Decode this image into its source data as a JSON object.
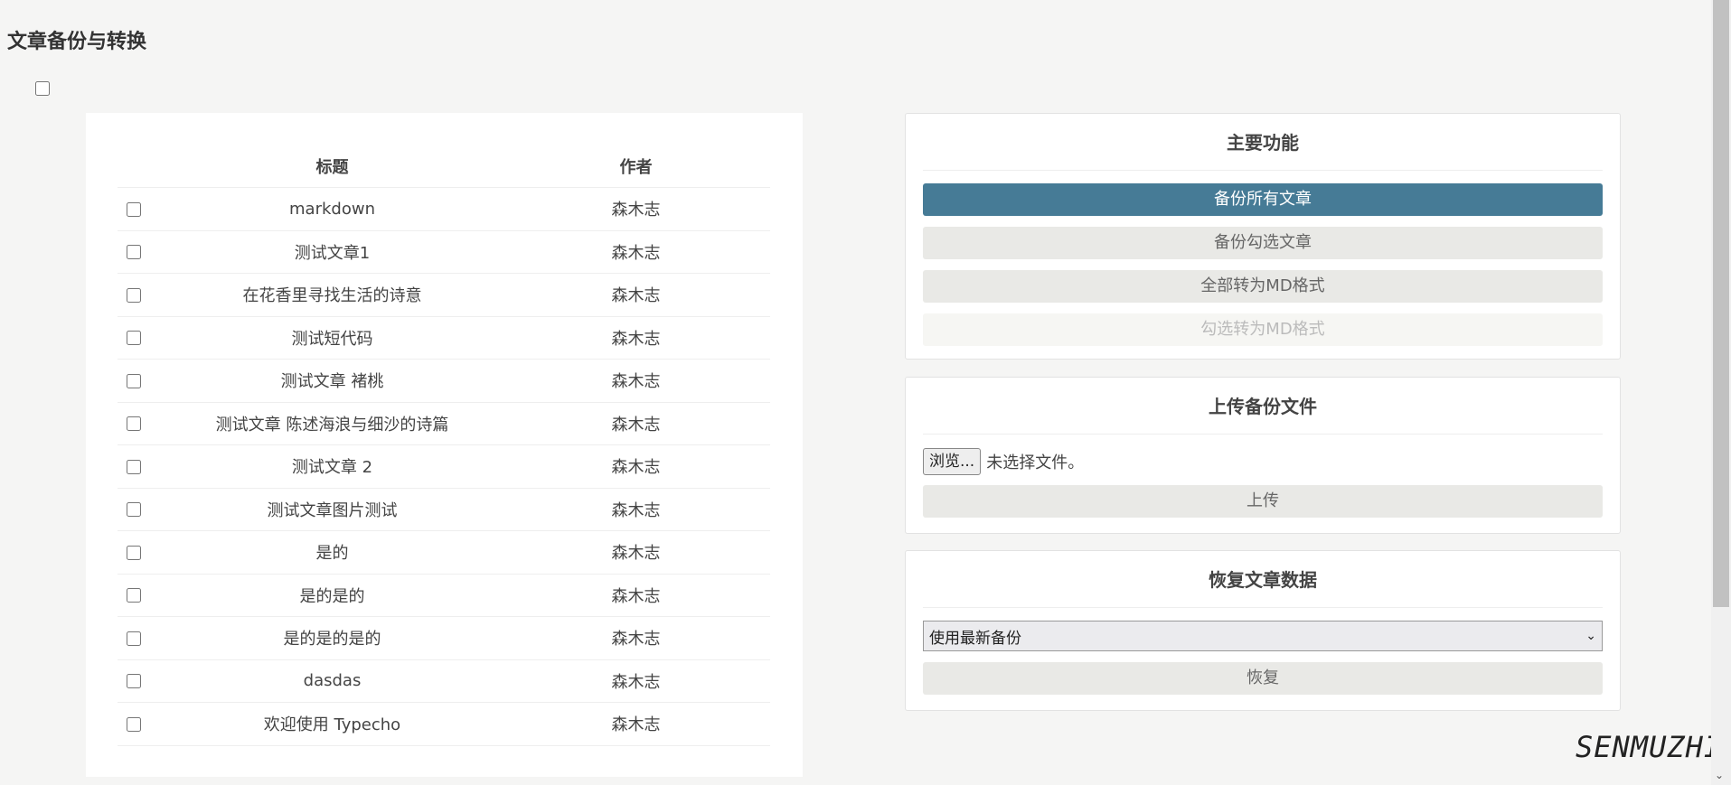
{
  "page": {
    "title": "文章备份与转换"
  },
  "table": {
    "headers": {
      "title": "标题",
      "author": "作者"
    },
    "rows": [
      {
        "title": "markdown",
        "author": "森木志"
      },
      {
        "title": "测试文章1",
        "author": "森木志"
      },
      {
        "title": "在花香里寻找生活的诗意",
        "author": "森木志"
      },
      {
        "title": "测试短代码",
        "author": "森木志"
      },
      {
        "title": "测试文章 褚桃",
        "author": "森木志"
      },
      {
        "title": "测试文章 陈述海浪与细沙的诗篇",
        "author": "森木志"
      },
      {
        "title": "测试文章 2",
        "author": "森木志"
      },
      {
        "title": "测试文章图片测试",
        "author": "森木志"
      },
      {
        "title": "是的",
        "author": "森木志"
      },
      {
        "title": "是的是的",
        "author": "森木志"
      },
      {
        "title": "是的是的是的",
        "author": "森木志"
      },
      {
        "title": "dasdas",
        "author": "森木志"
      },
      {
        "title": "欢迎使用 Typecho",
        "author": "森木志"
      }
    ]
  },
  "main_functions": {
    "heading": "主要功能",
    "backup_all": "备份所有文章",
    "backup_selected": "备份勾选文章",
    "convert_all_md": "全部转为MD格式",
    "convert_selected_md": "勾选转为MD格式"
  },
  "upload": {
    "heading": "上传备份文件",
    "browse_label": "浏览...",
    "no_file_text": "未选择文件。",
    "upload_button": "上传"
  },
  "restore": {
    "heading": "恢复文章数据",
    "selected_option": "使用最新备份",
    "restore_button": "恢复"
  },
  "colors": {
    "primary": "#467b96",
    "button_bg": "#e9e9e6",
    "page_bg": "#f5f5f4"
  },
  "logo_text": "SENMUZHI"
}
